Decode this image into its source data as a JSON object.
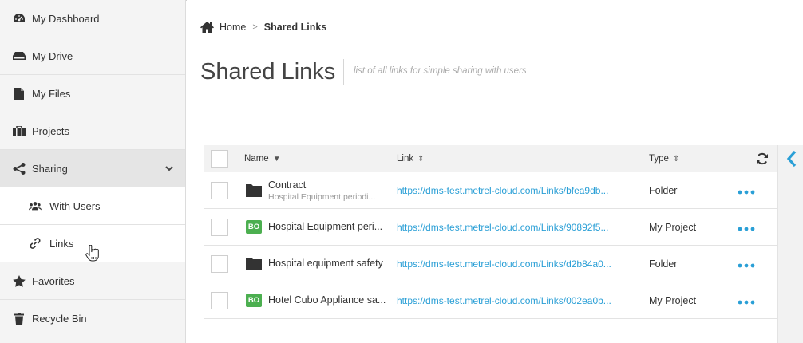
{
  "sidebar": {
    "items": [
      {
        "label": "My Dashboard",
        "icon": "dashboard-icon"
      },
      {
        "label": "My Drive",
        "icon": "drive-icon"
      },
      {
        "label": "My Files",
        "icon": "file-icon"
      },
      {
        "label": "Projects",
        "icon": "projects-icon"
      },
      {
        "label": "Sharing",
        "icon": "share-icon",
        "expanded": true,
        "active": true
      },
      {
        "label": "With Users",
        "icon": "users-icon",
        "sub": true
      },
      {
        "label": "Links",
        "icon": "link-icon",
        "sub": true,
        "hover": true
      },
      {
        "label": "Favorites",
        "icon": "star-icon"
      },
      {
        "label": "Recycle Bin",
        "icon": "trash-icon"
      }
    ]
  },
  "breadcrumb": {
    "home": "Home",
    "separator": ">",
    "current": "Shared Links"
  },
  "header": {
    "title": "Shared Links",
    "subtitle": "list of all links for simple sharing with users"
  },
  "table": {
    "columns": {
      "name": "Name",
      "link": "Link",
      "type": "Type"
    },
    "rows": [
      {
        "icon": "folder-icon",
        "name": "Contract",
        "subname": "Hospital Equipment periodi...",
        "link": "https://dms-test.metrel-cloud.com/Links/bfea9db...",
        "type": "Folder"
      },
      {
        "icon": "bo-project-icon",
        "badge": "BO",
        "name": "Hospital Equipment peri...",
        "link": "https://dms-test.metrel-cloud.com/Links/90892f5...",
        "type": "My Project"
      },
      {
        "icon": "folder-icon",
        "name": "Hospital equipment safety",
        "link": "https://dms-test.metrel-cloud.com/Links/d2b84a0...",
        "type": "Folder"
      },
      {
        "icon": "bo-project-icon",
        "badge": "BO",
        "name": "Hotel Cubo Appliance sa...",
        "link": "https://dms-test.metrel-cloud.com/Links/002ea0b...",
        "type": "My Project"
      }
    ]
  },
  "colors": {
    "accent": "#2a9fd6",
    "bo_badge": "#4caf50",
    "sidebar_bg": "#f4f4f4",
    "header_bg": "#f2f2f2"
  }
}
